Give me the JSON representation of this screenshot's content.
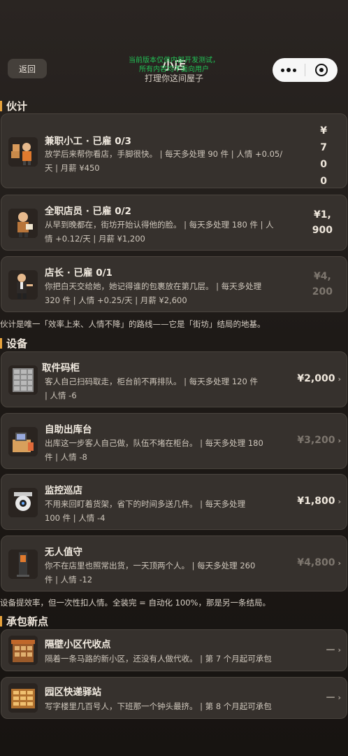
{
  "header": {
    "back_label": "返回",
    "title": "小店",
    "subtitle": "打理你这间屋子",
    "test_notice_line1": "当前版本仅供内部开发测试，",
    "test_notice_line2": "所有内容均不面向用户"
  },
  "sections": {
    "staff": "伙计",
    "equipment": "设备",
    "contract": "承包新点"
  },
  "staff": [
    {
      "name": "兼职小工 · 已雇 0/3",
      "desc_line1": "放学后来帮你看店，手脚很快。 | 每天多处理 90 件 | 人情 +0.05/",
      "desc_line2": "天 | 月薪 ¥450",
      "price_lines": [
        "¥",
        "7",
        "0",
        "0"
      ],
      "icon": "part-time-worker-icon"
    },
    {
      "name": "全职店员 · 已雇 0/2",
      "desc_line1": "从早到晚都在，街坊开始认得他的脸。 | 每天多处理 180 件 | 人",
      "desc_line2": "情 +0.12/天 | 月薪 ¥1,200",
      "price_lines": [
        "¥1,",
        "900"
      ],
      "icon": "full-time-clerk-icon"
    },
    {
      "name": "店长 · 已雇 0/1",
      "desc_line1": "你把白天交给她，她记得谁的包裹放在第几层。 | 每天多处理",
      "desc_line2": "320 件 | 人情 +0.25/天 | 月薪 ¥2,600",
      "price_lines": [
        "¥4,",
        "200"
      ],
      "icon": "manager-icon"
    }
  ],
  "staff_note": "伙计是唯一「效率上来、人情不降」的路线——它是「街坊」结局的地基。",
  "equipment": [
    {
      "name": "取件码柜",
      "desc_line1": "客人自己扫码取走，柜台前不再排队。 | 每天多处理 120 件",
      "desc_line2": "| 人情 -6",
      "price": "¥2,000",
      "dim": false,
      "icon": "locker-icon"
    },
    {
      "name": "自助出库台",
      "desc_line1": "出库这一步客人自己做，队伍不堵在柜台。 | 每天多处理 180",
      "desc_line2": "件 | 人情 -8",
      "price": "¥3,200",
      "dim": true,
      "icon": "self-checkout-icon"
    },
    {
      "name": "监控巡店",
      "desc_line1": "不用来回盯着货架，省下的时间多送几件。 | 每天多处理",
      "desc_line2": "100 件 | 人情 -4",
      "price": "¥1,800",
      "dim": false,
      "icon": "camera-icon"
    },
    {
      "name": "无人值守",
      "desc_line1": "你不在店里也照常出货，一天顶两个人。 | 每天多处理 260",
      "desc_line2": "件 | 人情 -12",
      "price": "¥4,800",
      "dim": true,
      "icon": "kiosk-icon"
    }
  ],
  "equipment_note": "设备提效率，但一次性扣人情。全装完 = 自动化 100%，那是另一条结局。",
  "contracts": [
    {
      "name": "隔壁小区代收点",
      "desc": "隔着一条马路的新小区，还没有人做代收。 | 第 7 个月起可承包",
      "price": "—",
      "icon": "stall-icon"
    },
    {
      "name": "园区快递驿站",
      "desc": "写字楼里几百号人，下班那一个钟头最挤。 | 第 8 个月起可承包",
      "price": "—",
      "icon": "station-icon"
    }
  ],
  "colors": {
    "accent": "#e6a23c",
    "card": "#36312d",
    "notice": "#22c055"
  }
}
